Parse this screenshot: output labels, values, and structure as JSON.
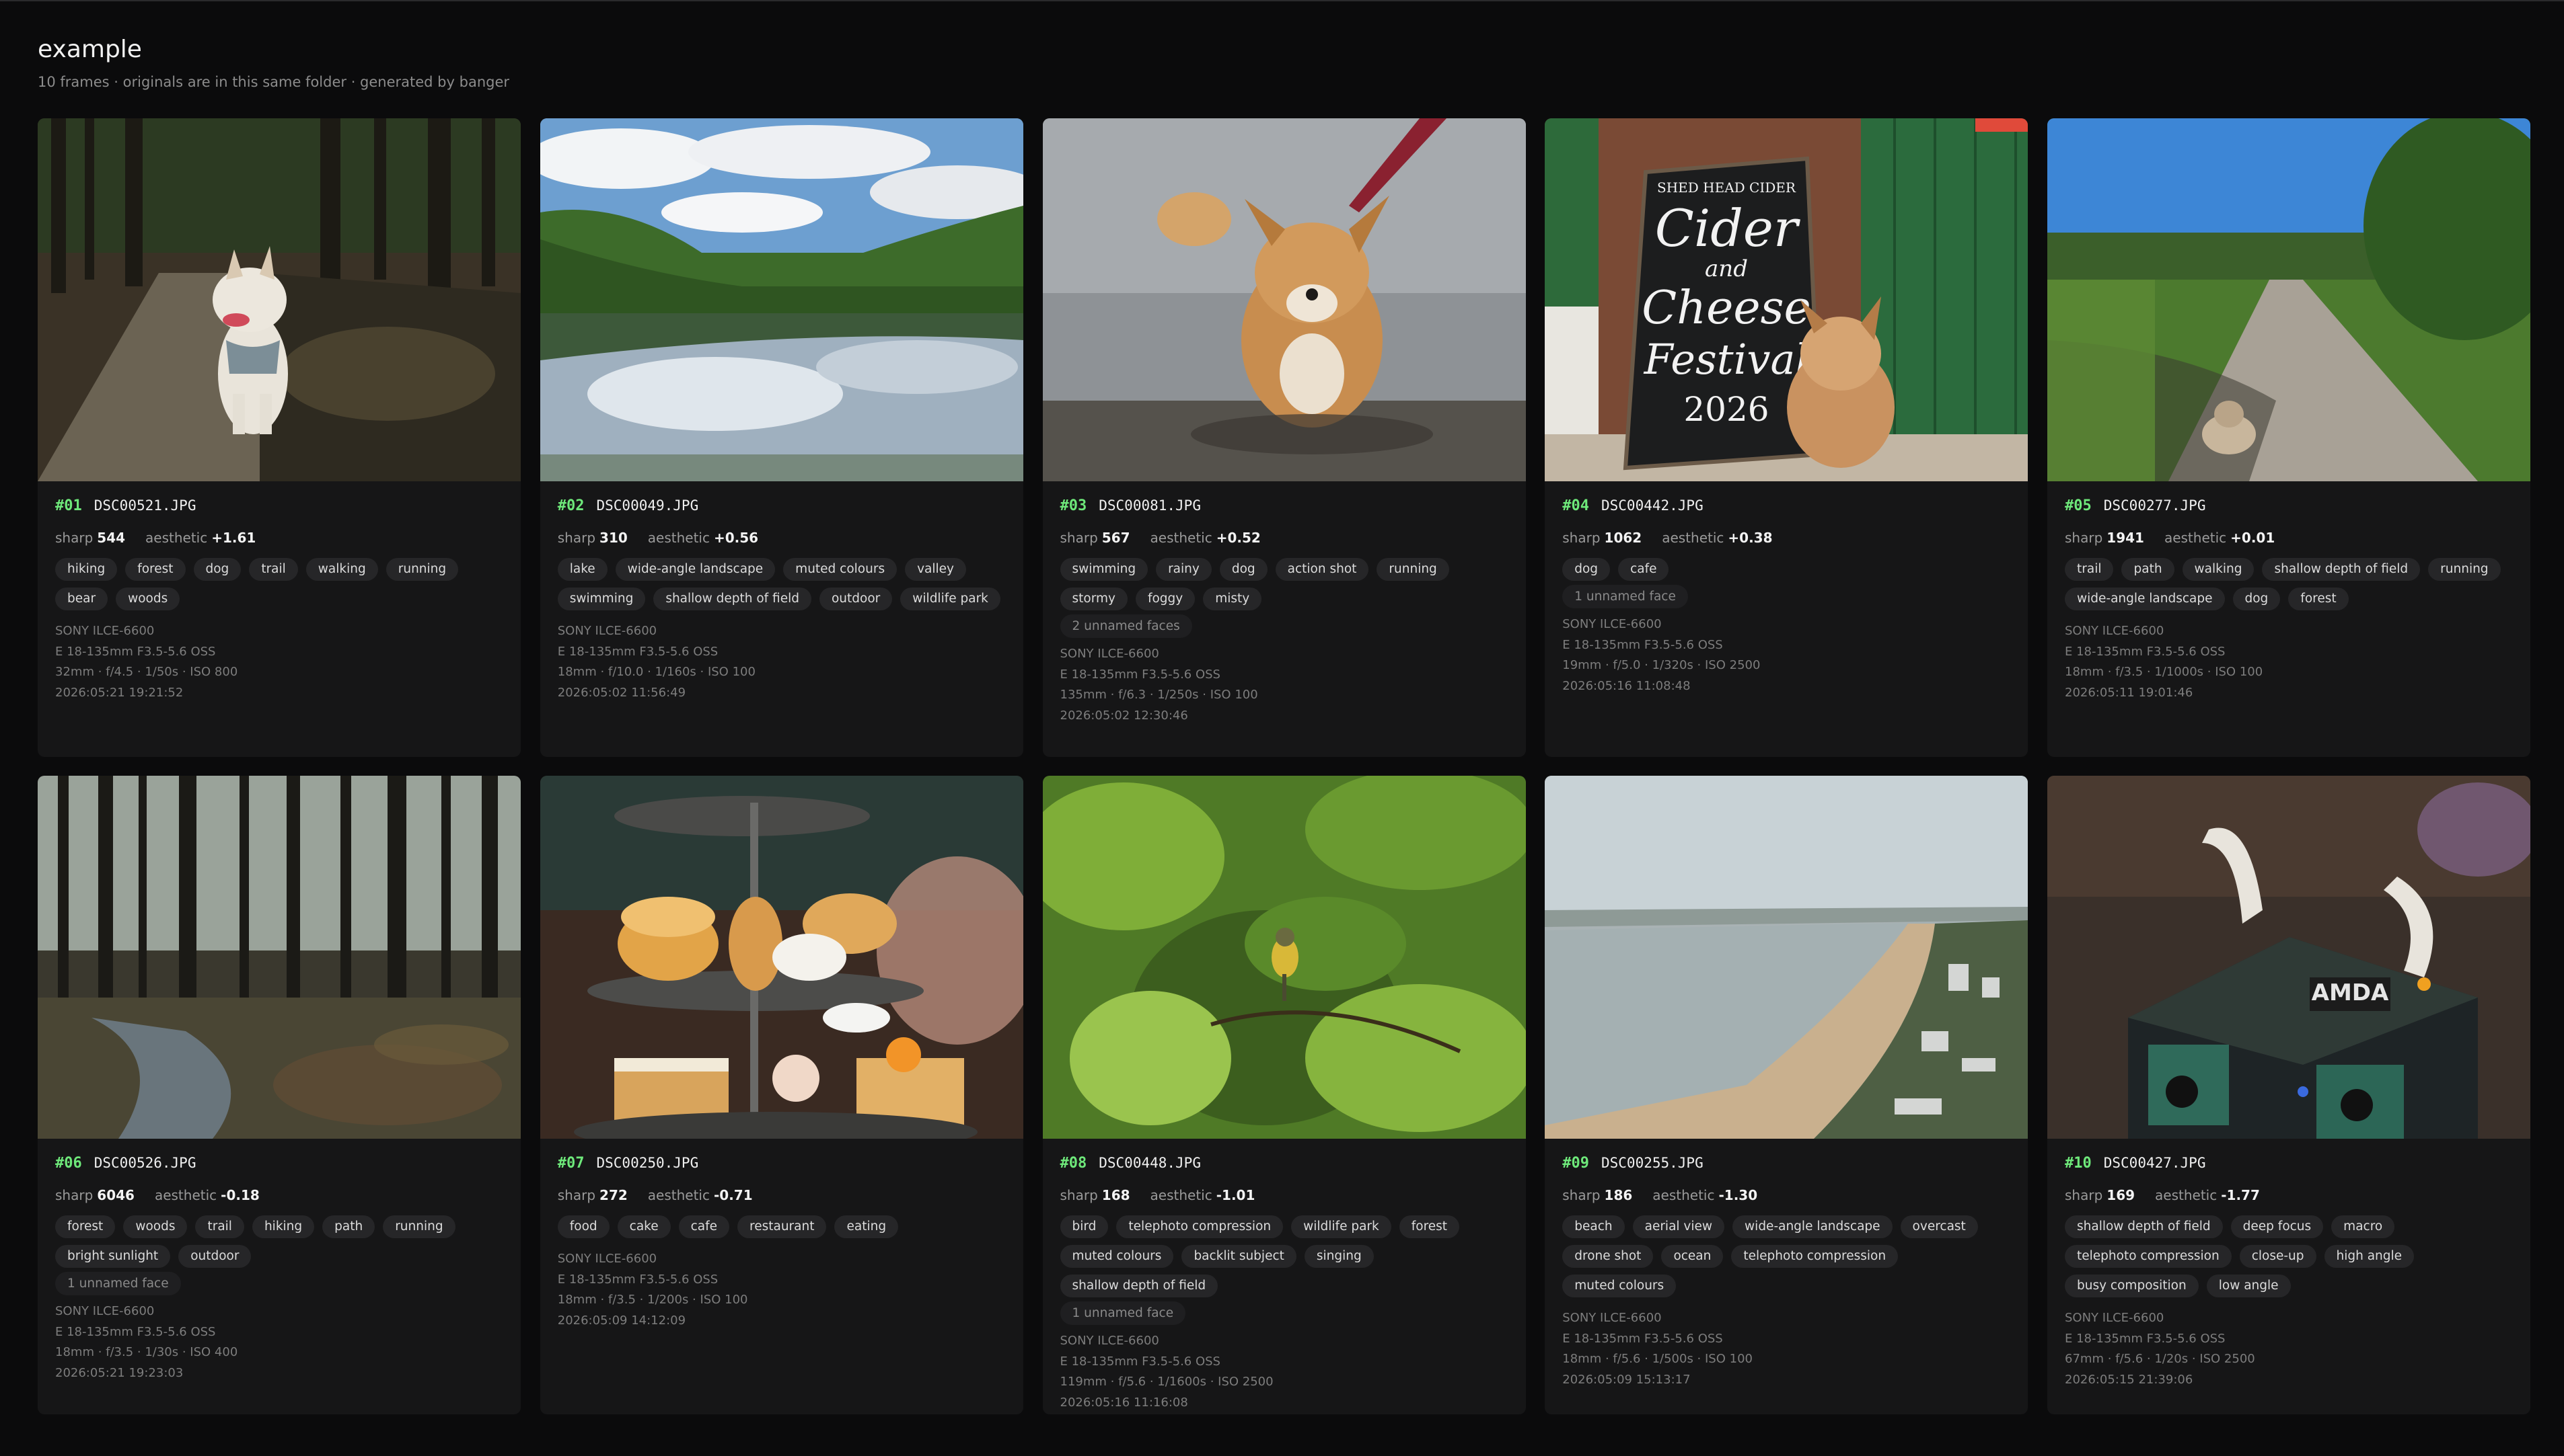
{
  "page": {
    "title": "example",
    "subtitle": "10 frames · originals are in this same folder · generated by banger"
  },
  "score_labels": {
    "sharp": "sharp",
    "aesthetic": "aesthetic"
  },
  "cards": [
    {
      "rank": "#01",
      "file": "DSC00521.JPG",
      "sharp": "544",
      "aesthetic": "+1.61",
      "tags": [
        "hiking",
        "forest",
        "dog",
        "trail",
        "walking",
        "running",
        "bear",
        "woods"
      ],
      "faces": "",
      "camera": "SONY ILCE-6600",
      "lens": "E 18-135mm F3.5-5.6 OSS",
      "exposure": "32mm · f/4.5 · 1/50s · ISO 800",
      "date": "2026:05:21 19:21:52"
    },
    {
      "rank": "#02",
      "file": "DSC00049.JPG",
      "sharp": "310",
      "aesthetic": "+0.56",
      "tags": [
        "lake",
        "wide-angle landscape",
        "muted colours",
        "valley",
        "swimming",
        "shallow depth of field",
        "outdoor",
        "wildlife park"
      ],
      "faces": "",
      "camera": "SONY ILCE-6600",
      "lens": "E 18-135mm F3.5-5.6 OSS",
      "exposure": "18mm · f/10.0 · 1/160s · ISO 100",
      "date": "2026:05:02 11:56:49"
    },
    {
      "rank": "#03",
      "file": "DSC00081.JPG",
      "sharp": "567",
      "aesthetic": "+0.52",
      "tags": [
        "swimming",
        "rainy",
        "dog",
        "action shot",
        "running",
        "stormy",
        "foggy",
        "misty"
      ],
      "faces": "2 unnamed faces",
      "camera": "SONY ILCE-6600",
      "lens": "E 18-135mm F3.5-5.6 OSS",
      "exposure": "135mm · f/6.3 · 1/250s · ISO 100",
      "date": "2026:05:02 12:30:46"
    },
    {
      "rank": "#04",
      "file": "DSC00442.JPG",
      "sharp": "1062",
      "aesthetic": "+0.38",
      "tags": [
        "dog",
        "cafe"
      ],
      "faces": "1 unnamed face",
      "camera": "SONY ILCE-6600",
      "lens": "E 18-135mm F3.5-5.6 OSS",
      "exposure": "19mm · f/5.0 · 1/320s · ISO 2500",
      "date": "2026:05:16 11:08:48"
    },
    {
      "rank": "#05",
      "file": "DSC00277.JPG",
      "sharp": "1941",
      "aesthetic": "+0.01",
      "tags": [
        "trail",
        "path",
        "walking",
        "shallow depth of field",
        "running",
        "wide-angle landscape",
        "dog",
        "forest"
      ],
      "faces": "",
      "camera": "SONY ILCE-6600",
      "lens": "E 18-135mm F3.5-5.6 OSS",
      "exposure": "18mm · f/3.5 · 1/1000s · ISO 100",
      "date": "2026:05:11 19:01:46"
    },
    {
      "rank": "#06",
      "file": "DSC00526.JPG",
      "sharp": "6046",
      "aesthetic": "-0.18",
      "tags": [
        "forest",
        "woods",
        "trail",
        "hiking",
        "path",
        "running",
        "bright sunlight",
        "outdoor"
      ],
      "faces": "1 unnamed face",
      "camera": "SONY ILCE-6600",
      "lens": "E 18-135mm F3.5-5.6 OSS",
      "exposure": "18mm · f/3.5 · 1/30s · ISO 400",
      "date": "2026:05:21 19:23:03"
    },
    {
      "rank": "#07",
      "file": "DSC00250.JPG",
      "sharp": "272",
      "aesthetic": "-0.71",
      "tags": [
        "food",
        "cake",
        "cafe",
        "restaurant",
        "eating"
      ],
      "faces": "",
      "camera": "SONY ILCE-6600",
      "lens": "E 18-135mm F3.5-5.6 OSS",
      "exposure": "18mm · f/3.5 · 1/200s · ISO 100",
      "date": "2026:05:09 14:12:09"
    },
    {
      "rank": "#08",
      "file": "DSC00448.JPG",
      "sharp": "168",
      "aesthetic": "-1.01",
      "tags": [
        "bird",
        "telephoto compression",
        "wildlife park",
        "forest",
        "muted colours",
        "backlit subject",
        "singing",
        "shallow depth of field"
      ],
      "faces": "1 unnamed face",
      "camera": "SONY ILCE-6600",
      "lens": "E 18-135mm F3.5-5.6 OSS",
      "exposure": "119mm · f/5.6 · 1/1600s · ISO 2500",
      "date": "2026:05:16 11:16:08"
    },
    {
      "rank": "#09",
      "file": "DSC00255.JPG",
      "sharp": "186",
      "aesthetic": "-1.30",
      "tags": [
        "beach",
        "aerial view",
        "wide-angle landscape",
        "overcast",
        "drone shot",
        "ocean",
        "telephoto compression",
        "muted colours"
      ],
      "faces": "",
      "camera": "SONY ILCE-6600",
      "lens": "E 18-135mm F3.5-5.6 OSS",
      "exposure": "18mm · f/5.6 · 1/500s · ISO 100",
      "date": "2026:05:09 15:13:17"
    },
    {
      "rank": "#10",
      "file": "DSC00427.JPG",
      "sharp": "169",
      "aesthetic": "-1.77",
      "tags": [
        "shallow depth of field",
        "deep focus",
        "macro",
        "telephoto compression",
        "close-up",
        "high angle",
        "busy composition",
        "low angle"
      ],
      "faces": "",
      "camera": "SONY ILCE-6600",
      "lens": "E 18-135mm F3.5-5.6 OSS",
      "exposure": "67mm · f/5.6 · 1/20s · ISO 2500",
      "date": "2026:05:15 21:39:06"
    }
  ],
  "photo_art": {
    "sign_lines": [
      "SHED HEAD CIDER",
      "Cider",
      "and",
      "Cheese",
      "Festival",
      "2026"
    ],
    "board_lettering": "AMDA"
  }
}
